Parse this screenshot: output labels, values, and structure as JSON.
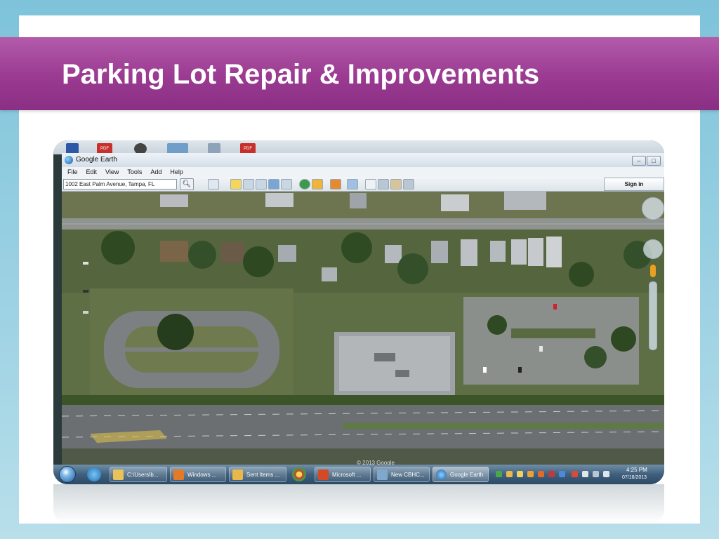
{
  "slide": {
    "title": "Parking Lot Repair & Improvements"
  },
  "desktop": {
    "pdf_label": "PDF"
  },
  "window": {
    "title": "Google Earth",
    "minimize": "–",
    "maximize": "□",
    "close": "✕"
  },
  "menu": {
    "items": [
      "File",
      "Edit",
      "View",
      "Tools",
      "Add",
      "Help"
    ]
  },
  "toolbar": {
    "search_value": "1002 East Palm Avenue, Tampa, FL",
    "sign_in_label": "Sign in"
  },
  "map": {
    "copyright": "© 2013 Google"
  },
  "taskbar": {
    "buttons": [
      {
        "label": "C:\\Users\\b...",
        "icon": "folder-icon"
      },
      {
        "label": "Windows ...",
        "icon": "media-player-icon"
      },
      {
        "label": "Sent Items ...",
        "icon": "outlook-icon"
      },
      {
        "label": "Microsoft ...",
        "icon": "powerpoint-icon"
      },
      {
        "label": "New CBHC...",
        "icon": "window-icon"
      },
      {
        "label": "Google Earth",
        "icon": "google-earth-icon"
      }
    ],
    "clock_time": "4:25 PM",
    "clock_date": "07/18/2013"
  },
  "colors": {
    "title_band": "#9a3a91",
    "slide_bg": "#8fc8dc"
  }
}
